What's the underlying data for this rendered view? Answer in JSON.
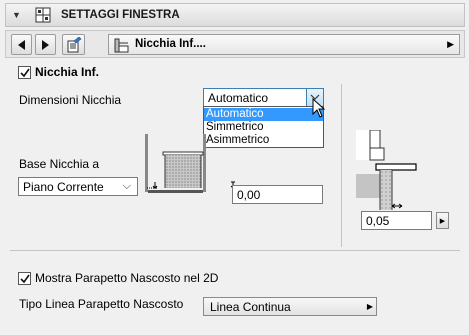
{
  "header": {
    "title": "SETTAGGI FINESTRA"
  },
  "nav": {
    "title": "Nicchia Inf...."
  },
  "nicchia_inf": {
    "checkbox_label": "Nicchia Inf.",
    "checked": true
  },
  "dimensioni": {
    "label": "Dimensioni Nicchia",
    "value": "Automatico",
    "options": [
      "Automatico",
      "Simmetrico",
      "Asimmetrico"
    ],
    "selected_index": 0
  },
  "base": {
    "label": "Base Nicchia a",
    "value": "Piano Corrente",
    "offset_value": "0,00"
  },
  "right_field": {
    "value": "0,05"
  },
  "parapetto": {
    "checkbox_label": "Mostra Parapetto Nascosto nel 2D",
    "checked": true,
    "tipo_label": "Tipo Linea Parapetto Nascosto",
    "tipo_value": "Linea Continua"
  }
}
